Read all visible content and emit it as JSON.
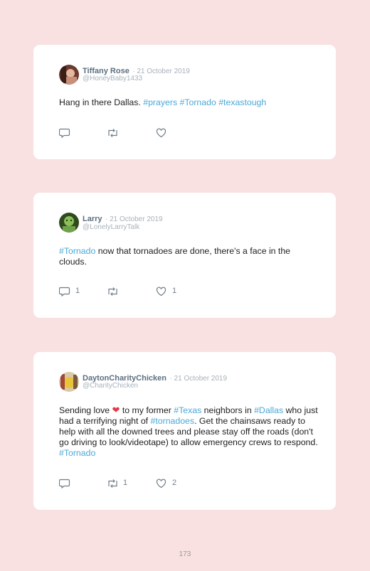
{
  "page_number": "173",
  "colors": {
    "background": "#f9e0e1",
    "card": "#ffffff",
    "hashtag": "#4aa8d8",
    "name": "#5c6f80",
    "meta": "#a7b2bc"
  },
  "tweets": [
    {
      "name": "Tiffany Rose",
      "date": "· 21 October 2019",
      "handle": "@HoneyBaby1433",
      "text_parts": [
        {
          "t": "Hang in there Dallas. "
        },
        {
          "t": "#prayers",
          "tag": true
        },
        {
          "t": " "
        },
        {
          "t": "#Tornado",
          "tag": true
        },
        {
          "t": " "
        },
        {
          "t": "#texastough",
          "tag": true
        }
      ],
      "actions": {
        "reply_icon": "reply-icon",
        "retweet_icon": "retweet-icon",
        "like_icon": "heart-icon",
        "reply_count": "",
        "retweet_count": "",
        "like_count": ""
      }
    },
    {
      "name": "Larry",
      "date": "· 21 October 2019",
      "handle": "@LonelyLarryTalk",
      "text_parts": [
        {
          "t": "#Tornado",
          "tag": true
        },
        {
          "t": " now that tornadoes are done, there's a face in the clouds."
        }
      ],
      "actions": {
        "reply_icon": "reply-icon",
        "retweet_icon": "retweet-icon",
        "like_icon": "heart-icon",
        "reply_count": "1",
        "retweet_count": "",
        "like_count": "1"
      }
    },
    {
      "name": "DaytonCharityChicken",
      "date": "· 21 October 2019",
      "handle": "@CharityChicken",
      "text_parts": [
        {
          "t": "Sending love "
        },
        {
          "t": "❤",
          "emoji": true
        },
        {
          "t": " to my former "
        },
        {
          "t": "#Texas",
          "tag": true
        },
        {
          "t": " neighbors in "
        },
        {
          "t": "#Dallas",
          "tag": true
        },
        {
          "t": " who just had a terrifying night of "
        },
        {
          "t": "#tornadoes",
          "tag": true
        },
        {
          "t": ". Get the chainsaws ready to help with all the downed trees and please stay off the roads (don't go driving to look/videotape) to allow emergency crews to respond. "
        },
        {
          "t": "#Tornado",
          "tag": true
        }
      ],
      "actions": {
        "reply_icon": "reply-icon",
        "retweet_icon": "retweet-icon",
        "like_icon": "heart-icon",
        "reply_count": "",
        "retweet_count": "1",
        "like_count": "2"
      }
    }
  ]
}
